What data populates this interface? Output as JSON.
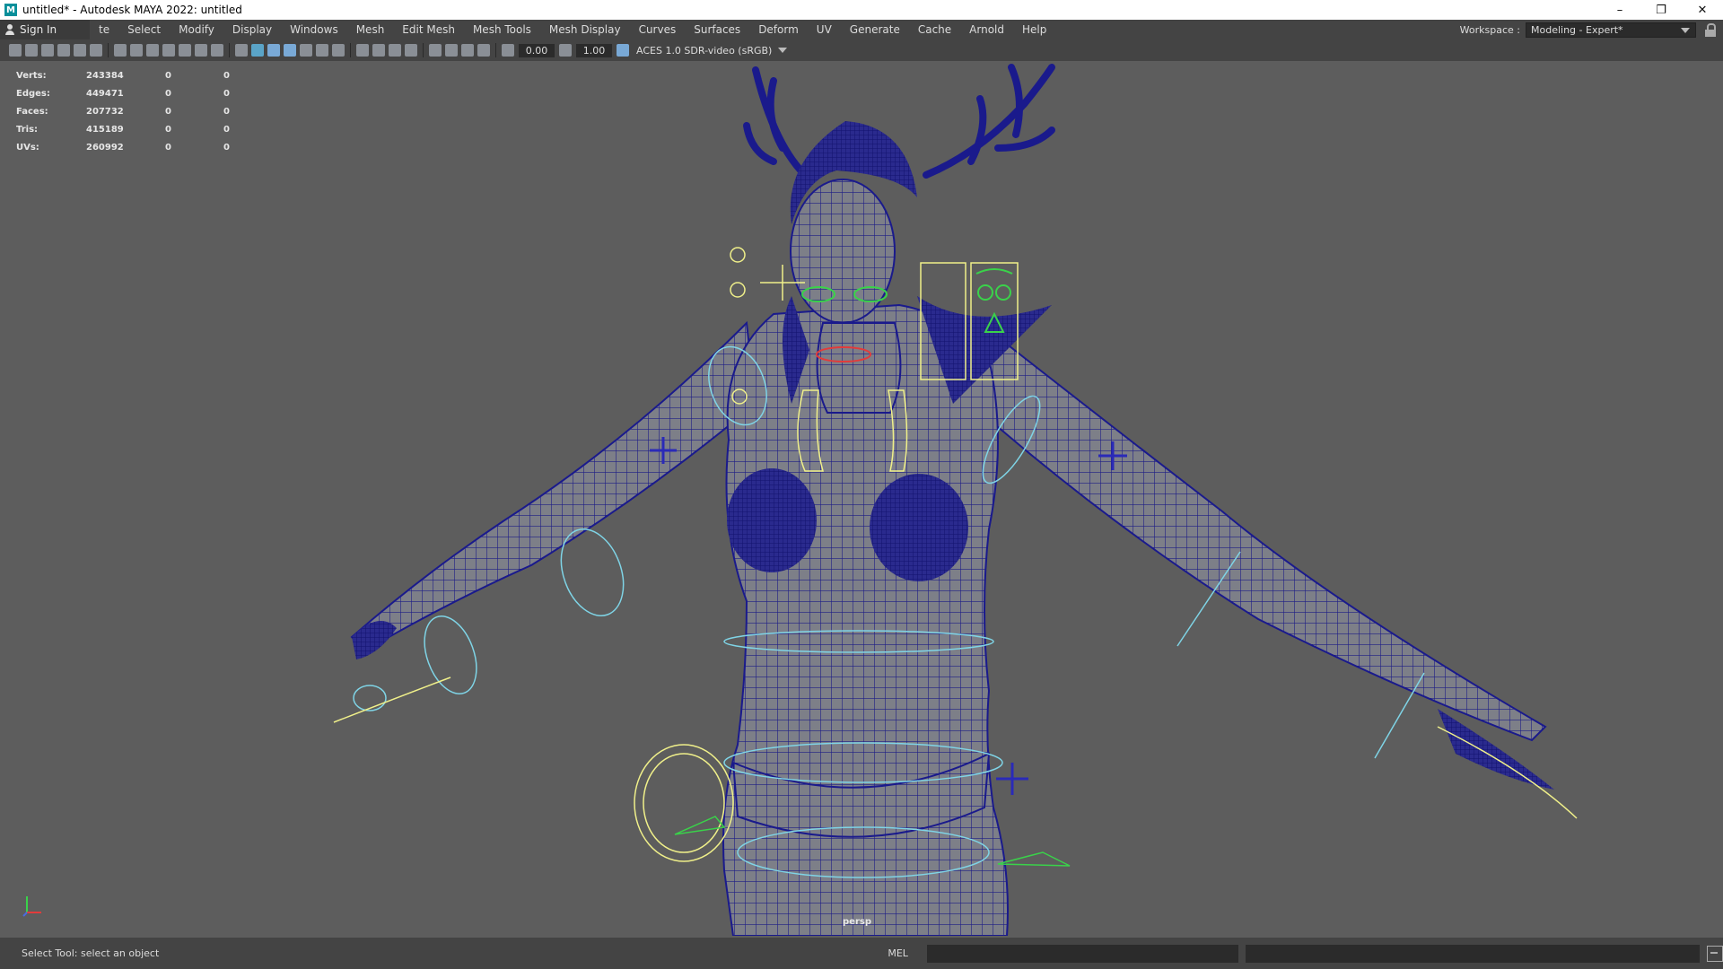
{
  "window": {
    "title": "untitled* - Autodesk MAYA 2022: untitled",
    "app_icon": "M",
    "controls": [
      "minimize-icon",
      "restore-icon",
      "close-icon"
    ]
  },
  "menubar": {
    "signin_label": "Sign In",
    "items": [
      "te",
      "Select",
      "Modify",
      "Display",
      "Windows",
      "Mesh",
      "Edit Mesh",
      "Mesh Tools",
      "Mesh Display",
      "Curves",
      "Surfaces",
      "Deform",
      "UV",
      "Generate",
      "Cache",
      "Arnold",
      "Help"
    ],
    "workspace_label": "Workspace :",
    "workspace_value": "Modeling - Expert*"
  },
  "panel_toolbar": {
    "exposure_value": "0.00",
    "gamma_value": "1.00",
    "color_space": "ACES 1.0 SDR-video (sRGB)"
  },
  "hud": {
    "rows": [
      {
        "label": "Verts:",
        "value": "243384",
        "sel": "0",
        "comp": "0"
      },
      {
        "label": "Edges:",
        "value": "449471",
        "sel": "0",
        "comp": "0"
      },
      {
        "label": "Faces:",
        "value": "207732",
        "sel": "0",
        "comp": "0"
      },
      {
        "label": "Tris:",
        "value": "415189",
        "sel": "0",
        "comp": "0"
      },
      {
        "label": "UVs:",
        "value": "260992",
        "sel": "0",
        "comp": "0"
      }
    ]
  },
  "viewport": {
    "camera_label": "persp",
    "colors": {
      "background": "#5d5d5d",
      "mesh": "#1a1a8c",
      "rig_cyan": "#7fd4e6",
      "rig_yellow": "#f0f08a",
      "rig_green": "#3ad24a"
    }
  },
  "statusbar": {
    "help_line": "Select Tool: select an object",
    "command_language": "MEL"
  }
}
